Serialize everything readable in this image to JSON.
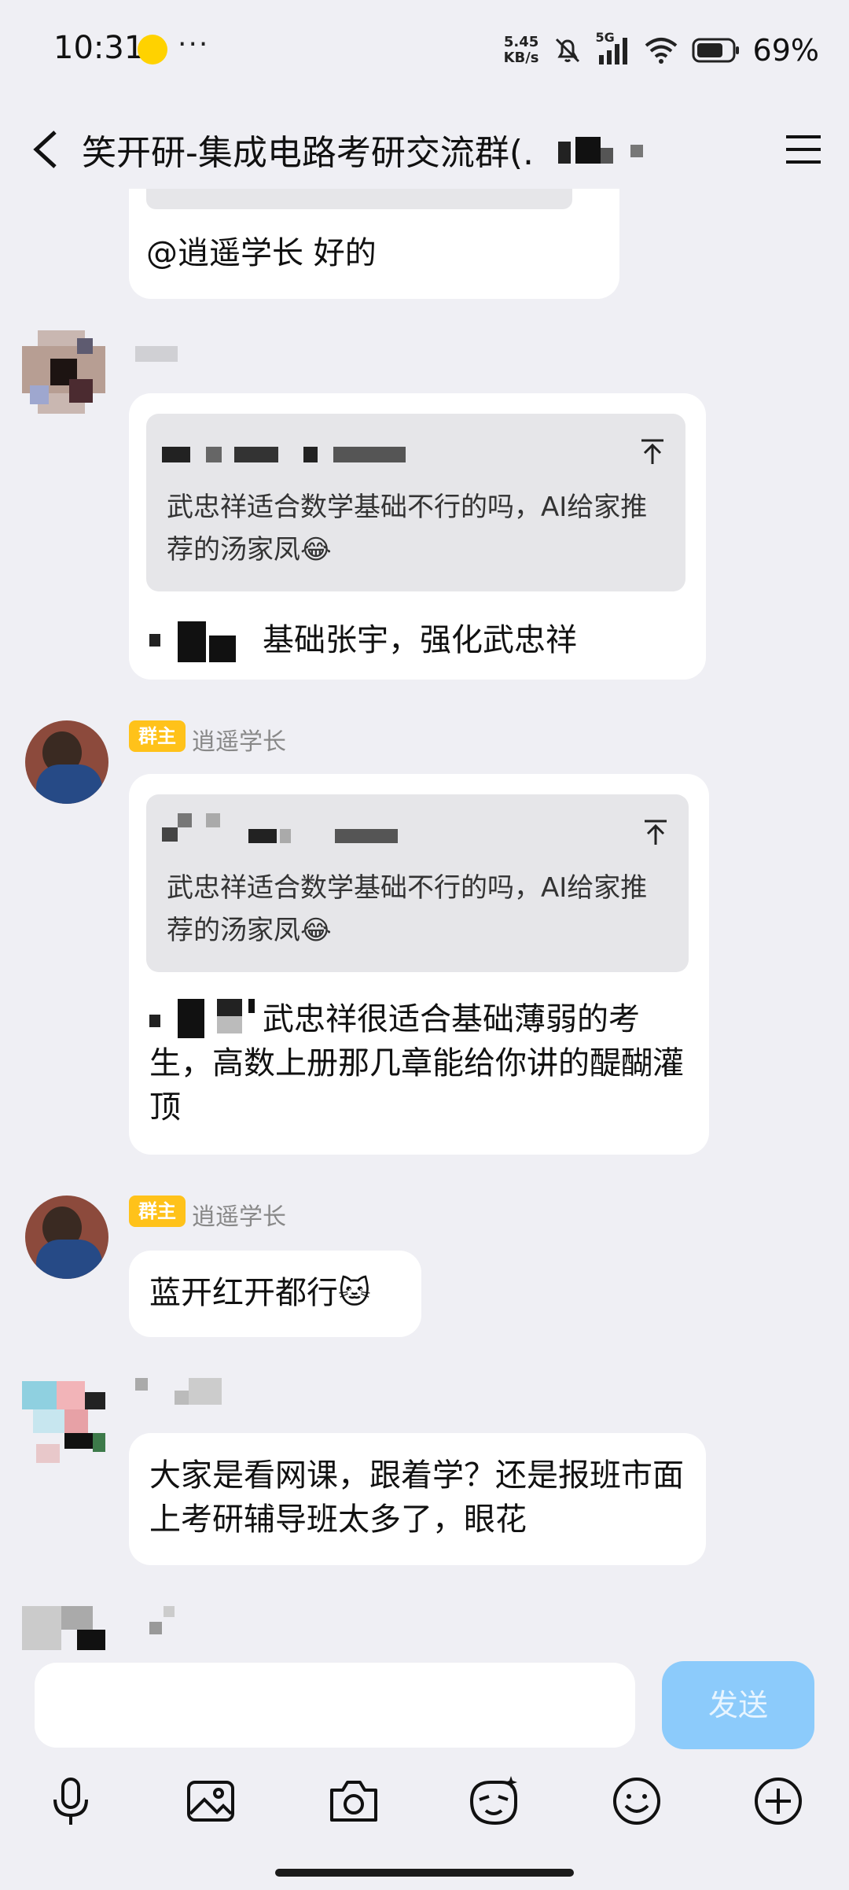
{
  "status_bar": {
    "time": "10:31",
    "more": "···",
    "net_speed_value": "5.45",
    "net_speed_unit": "KB/s",
    "signal_label": "5G",
    "battery": "69%"
  },
  "header": {
    "title": "笑开研-集成电路考研交流群(."
  },
  "messages": {
    "m1": {
      "text": "@逍遥学长 好的"
    },
    "m2": {
      "quote_text": "武忠祥适合数学基础不行的吗，AI给家推荐的汤家凤😂",
      "text": "基础张宇，强化武忠祥"
    },
    "m3": {
      "badge": "群主",
      "sender": "逍遥学长",
      "quote_text": "武忠祥适合数学基础不行的吗，AI给家推荐的汤家凤😂",
      "text": "武忠祥很适合基础薄弱的考生，高数上册那几章能给你讲的醍醐灌顶"
    },
    "m4": {
      "badge": "群主",
      "sender": "逍遥学长",
      "text": "蓝开红开都行🐱"
    },
    "m5": {
      "text": "大家是看网课，跟着学？还是报班市面上考研辅导班太多了，眼花"
    }
  },
  "input": {
    "placeholder": "",
    "send_label": "发送"
  },
  "icons": {
    "toolbar": [
      "microphone-icon",
      "image-icon",
      "camera-icon",
      "sticker-icon",
      "emoji-icon",
      "plus-icon"
    ]
  },
  "colors": {
    "background": "#efeff4",
    "bubble": "#ffffff",
    "badge": "#ffc21a",
    "send_button": "#8ccbfb"
  }
}
